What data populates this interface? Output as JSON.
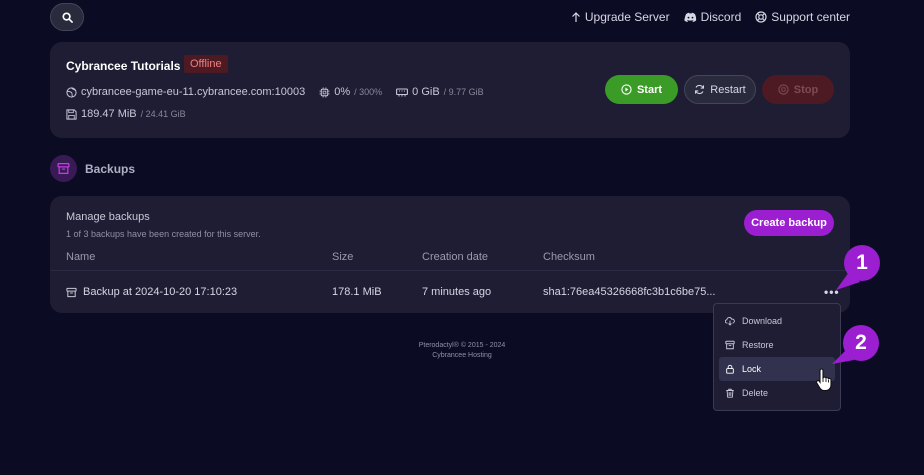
{
  "topnav": {
    "upgrade": "Upgrade Server",
    "discord": "Discord",
    "support": "Support center"
  },
  "server": {
    "name": "Cybrancee Tutorials",
    "status": "Offline",
    "address": "cybrancee-game-eu-11.cybrancee.com:10003",
    "cpu_value": "0%",
    "cpu_limit": "/ 300%",
    "memory_value": "0 GiB",
    "memory_limit": "/ 9.77 GiB",
    "disk_value": "189.47 MiB",
    "disk_limit": "/ 24.41 GiB",
    "buttons": {
      "start": "Start",
      "restart": "Restart",
      "stop": "Stop"
    }
  },
  "backups": {
    "section_title": "Backups",
    "manage_title": "Manage backups",
    "manage_sub": "1 of 3 backups have been created for this server.",
    "create_label": "Create backup",
    "columns": {
      "name": "Name",
      "size": "Size",
      "date": "Creation date",
      "checksum": "Checksum"
    },
    "rows": [
      {
        "name": "Backup at 2024-10-20 17:10:23",
        "size": "178.1 MiB",
        "date": "7 minutes ago",
        "checksum": "sha1:76ea45326668fc3b1c6be75..."
      }
    ],
    "more_label": "•••"
  },
  "dropdown": {
    "items": [
      {
        "label": "Download",
        "icon": "cloud-download-icon"
      },
      {
        "label": "Restore",
        "icon": "archive-icon"
      },
      {
        "label": "Lock",
        "icon": "lock-icon"
      },
      {
        "label": "Delete",
        "icon": "trash-icon"
      }
    ]
  },
  "footer": {
    "line1": "Pterodactyl® © 2015 - 2024",
    "line2": "Cybrancee Hosting"
  },
  "callouts": {
    "first": "1",
    "second": "2"
  },
  "colors": {
    "background": "#0c0b24",
    "card": "#1e1d33",
    "accent": "#9b1fd1",
    "start": "#3b9b27",
    "offline": "#4d1a24"
  }
}
